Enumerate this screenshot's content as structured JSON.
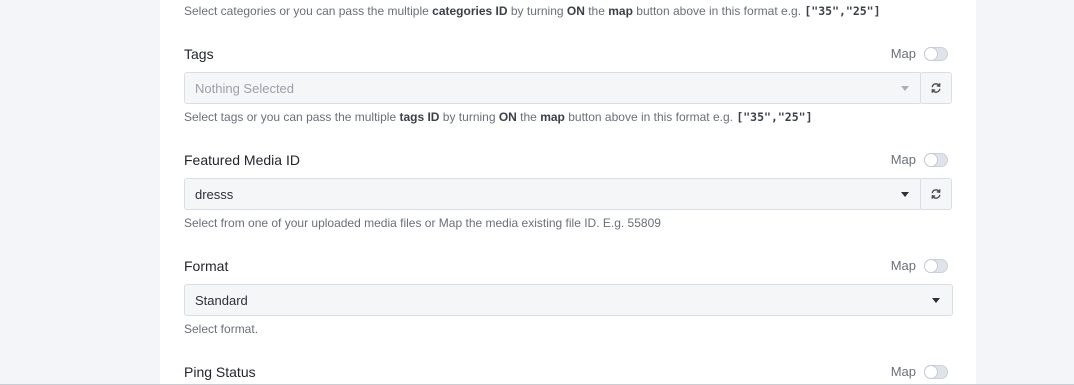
{
  "categories_help": {
    "pre": "Select categories or you can pass the multiple ",
    "b1": "categories ID",
    "mid1": " by turning ",
    "b2": "ON",
    "mid2": " the ",
    "b3": "map",
    "mid3": " button above in this format e.g. ",
    "code": "[\"35\",\"25\"]"
  },
  "fields": {
    "tags": {
      "label": "Tags",
      "map_label": "Map",
      "value": "Nothing Selected",
      "help": {
        "pre": "Select tags or you can pass the multiple ",
        "b1": "tags ID",
        "mid1": " by turning ",
        "b2": "ON",
        "mid2": " the ",
        "b3": "map",
        "mid3": " button above in this format e.g. ",
        "code": "[\"35\",\"25\"]"
      }
    },
    "featured_media": {
      "label": "Featured Media ID",
      "map_label": "Map",
      "value": "dresss",
      "help": "Select from one of your uploaded media files or Map the media existing file ID. E.g. 55809"
    },
    "format": {
      "label": "Format",
      "map_label": "Map",
      "value": "Standard",
      "help": "Select format."
    },
    "ping_status": {
      "label": "Ping Status",
      "map_label": "Map"
    }
  },
  "icons": {
    "refresh": "refresh-icon",
    "caret": "chevron-down-icon"
  }
}
